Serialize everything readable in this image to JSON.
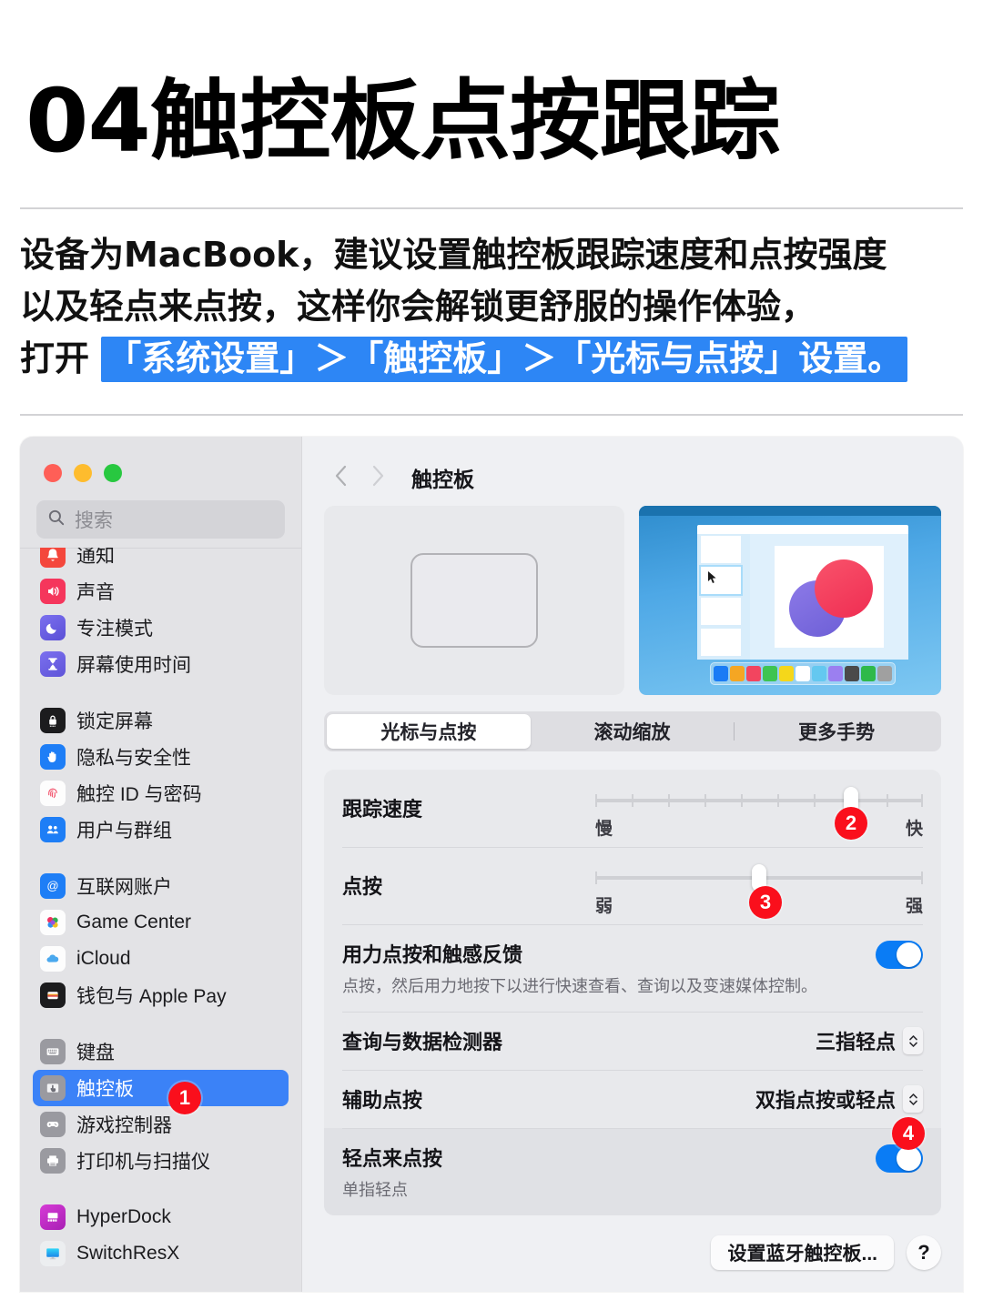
{
  "poster": {
    "title": "04触控板点按跟踪",
    "body_line1_a": "设备为",
    "body_line1_b": "MacBook",
    "body_line1_c": "，建议设置触控板跟踪速度和点按强度",
    "body_line2": "以及轻点来点按，这样你会解锁更舒服的操作体验，",
    "body_line3_prefix": "打开 ",
    "body_line3_highlight": "「系统设置」＞「触控板」＞「光标与点按」设置。"
  },
  "window": {
    "traffic_lights": [
      "close",
      "minimize",
      "zoom"
    ],
    "search": {
      "placeholder": "搜索",
      "icon": "search-icon"
    },
    "sidebar_groups": [
      {
        "items": [
          {
            "label": "通知",
            "icon": "bell-icon",
            "color": "#f4473c"
          },
          {
            "label": "声音",
            "icon": "speaker-icon",
            "color": "#f5365c"
          },
          {
            "label": "专注模式",
            "icon": "moon-icon",
            "color": "#6d63e8"
          },
          {
            "label": "屏幕使用时间",
            "icon": "hourglass-icon",
            "color": "#6f63e2"
          }
        ]
      },
      {
        "items": [
          {
            "label": "锁定屏幕",
            "icon": "lock-screen-icon",
            "color": "#1c1c1e"
          },
          {
            "label": "隐私与安全性",
            "icon": "hand-icon",
            "color": "#1e7ef6"
          },
          {
            "label": "触控 ID 与密码",
            "icon": "fingerprint-icon",
            "color": "#ffffff"
          },
          {
            "label": "用户与群组",
            "icon": "users-icon",
            "color": "#1e7ef6"
          }
        ]
      },
      {
        "items": [
          {
            "label": "互联网账户",
            "icon": "at-sign-icon",
            "color": "#1e7ef6"
          },
          {
            "label": "Game Center",
            "icon": "game-center-icon",
            "color": "#ffffff"
          },
          {
            "label": "iCloud",
            "icon": "icloud-icon",
            "color": "#ffffff"
          },
          {
            "label": "钱包与 Apple Pay",
            "icon": "wallet-icon",
            "color": "#1c1c1e"
          }
        ]
      },
      {
        "items": [
          {
            "label": "键盘",
            "icon": "keyboard-icon",
            "color": "#9a9aa0"
          },
          {
            "label": "触控板",
            "icon": "trackpad-icon",
            "color": "#9a9aa0",
            "selected": true
          },
          {
            "label": "游戏控制器",
            "icon": "gamepad-icon",
            "color": "#9a9aa0"
          },
          {
            "label": "打印机与扫描仪",
            "icon": "printer-icon",
            "color": "#9a9aa0"
          }
        ]
      },
      {
        "items": [
          {
            "label": "HyperDock",
            "icon": "hyperdock-icon",
            "color": "#c42ec4"
          },
          {
            "label": "SwitchResX",
            "icon": "switchresx-icon",
            "color": "#18c3f0"
          }
        ]
      }
    ],
    "nav": {
      "back_icon": "chevron-left-icon",
      "forward_icon": "chevron-right-icon",
      "title": "触控板"
    },
    "preview": {
      "trackpad_alt": "trackpad-illustration",
      "screen_alt": "desktop-preview-illustration",
      "swatches": [
        "#1a7bf5",
        "#f5a623",
        "#f2455f",
        "#3ec452",
        "#f5d71a",
        "#ffffff",
        "#64c8f0",
        "#9b7ff0",
        "#4a4a4a",
        "#2fb94a",
        "#a0a0a0"
      ]
    },
    "tabs": [
      {
        "label": "光标与点按",
        "active": true
      },
      {
        "label": "滚动缩放",
        "active": false
      },
      {
        "label": "更多手势",
        "active": false
      }
    ],
    "settings": {
      "tracking_speed": {
        "label": "跟踪速度",
        "min_label": "慢",
        "max_label": "快",
        "value_pct": 78,
        "ticks": 10
      },
      "click_pressure": {
        "label": "点按",
        "min_label": "弱",
        "max_label": "强",
        "value_pct": 50,
        "ticks": 0
      },
      "force_click": {
        "title": "用力点按和触感反馈",
        "subtitle": "点按，然后用力地按下以进行快速查看、查询以及变速媒体控制。",
        "enabled": true
      },
      "lookup": {
        "title": "查询与数据检测器",
        "value": "三指轻点"
      },
      "secondary_click": {
        "title": "辅助点按",
        "value": "双指点按或轻点"
      },
      "tap_to_click": {
        "title": "轻点来点按",
        "subtitle": "单指轻点",
        "enabled": true
      }
    },
    "footer": {
      "bluetooth_button": "设置蓝牙触控板...",
      "help_button": "?"
    }
  },
  "badges": [
    {
      "id": "1",
      "target": "sidebar-item-trackpad"
    },
    {
      "id": "2",
      "target": "tracking-speed-slider"
    },
    {
      "id": "3",
      "target": "click-pressure-slider"
    },
    {
      "id": "4",
      "target": "tap-to-click-switch"
    }
  ],
  "colors": {
    "accent": "#3b82f7",
    "badge_red": "#fa0f1c",
    "highlight_blue": "#2d86f5",
    "toggle_on": "#0a7cf5"
  }
}
